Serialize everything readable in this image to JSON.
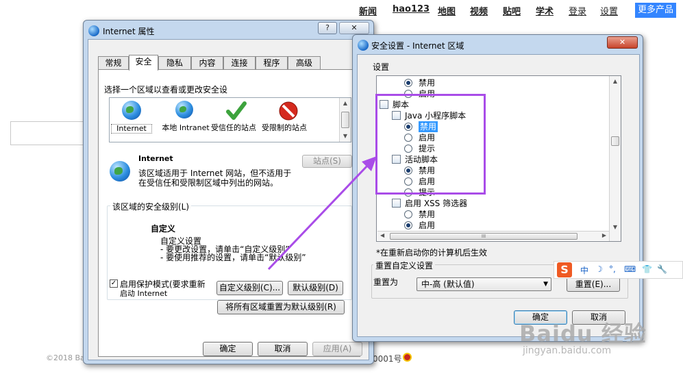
{
  "baidu": {
    "nav": [
      "新闻",
      "hao123",
      "地图",
      "视频",
      "贴吧",
      "学术",
      "登录",
      "设置"
    ],
    "more": "更多产品",
    "footer_copy": "©2018 Ba",
    "footer_icp": "0001号"
  },
  "internet_options": {
    "title": "Internet 属性",
    "help": "?",
    "close": "✕",
    "tabs": [
      "常规",
      "安全",
      "隐私",
      "内容",
      "连接",
      "程序",
      "高级"
    ],
    "active_tab": "安全",
    "select_zone_prompt": "选择一个区域以查看或更改安全设",
    "zones": [
      {
        "label": "Internet",
        "icon": "globe-icon"
      },
      {
        "label": "本地 Intranet",
        "icon": "intranet-icon"
      },
      {
        "label": "受信任的站点",
        "icon": "checkmark-icon"
      },
      {
        "label": "受限制的站点",
        "icon": "restricted-icon"
      }
    ],
    "zone_name": "Internet",
    "zone_desc_line1": "该区域适用于 Internet 网站，但不适用于",
    "zone_desc_line2": "在受信任和受限制区域中列出的网站。",
    "sites_button": "站点(S)",
    "security_level_group": "该区域的安全级别(L)",
    "custom_title": "自定义",
    "custom_line1": "自定义设置",
    "custom_line2": "- 要更改设置，请单击“自定义级别”",
    "custom_line3": "- 要使用推荐的设置，请单击“默认级别”",
    "protected_mode_line1": "启用保护模式(要求重新",
    "protected_mode_line2": "启动 Internet",
    "protected_mode_checked": true,
    "custom_level_button": "自定义级别(C)...",
    "default_level_button": "默认级别(D)",
    "reset_all_button": "将所有区域重置为默认级别(R)",
    "ok": "确定",
    "cancel": "取消",
    "apply": "应用(A)"
  },
  "security_settings": {
    "title": "安全设置 - Internet 区域",
    "close": "✕",
    "settings_label": "设置",
    "rows": [
      {
        "type": "radio",
        "label": "禁用",
        "checked": true,
        "indent": 2
      },
      {
        "type": "radio",
        "label": "启用",
        "checked": false,
        "indent": 2
      },
      {
        "type": "category",
        "label": "脚本",
        "indent": 0
      },
      {
        "type": "category",
        "label": "Java 小程序脚本",
        "indent": 1
      },
      {
        "type": "radio",
        "label": "禁用",
        "checked": true,
        "indent": 2,
        "selected": true
      },
      {
        "type": "radio",
        "label": "启用",
        "checked": false,
        "indent": 2
      },
      {
        "type": "radio",
        "label": "提示",
        "checked": false,
        "indent": 2
      },
      {
        "type": "category",
        "label": "活动脚本",
        "indent": 1
      },
      {
        "type": "radio",
        "label": "禁用",
        "checked": true,
        "indent": 2
      },
      {
        "type": "radio",
        "label": "启用",
        "checked": false,
        "indent": 2
      },
      {
        "type": "radio",
        "label": "提示",
        "checked": false,
        "indent": 2
      },
      {
        "type": "category",
        "label": "启用 XSS 筛选器",
        "indent": 1
      },
      {
        "type": "radio",
        "label": "禁用",
        "checked": false,
        "indent": 2
      },
      {
        "type": "radio",
        "label": "启用",
        "checked": true,
        "indent": 2
      }
    ],
    "restart_note": "*在重新启动你的计算机后生效",
    "reset_group": "重置自定义设置",
    "reset_to_label": "重置为",
    "reset_to_value": "中-高 (默认值)",
    "reset_button": "重置(E)...",
    "ok": "确定",
    "cancel": "取消"
  },
  "ime_toolbar": {
    "logo": "S",
    "items": [
      "中",
      "☽",
      "°,",
      "⌨",
      "👕",
      "🔧"
    ]
  },
  "watermark": {
    "main": "Baidu 经验",
    "sub": "jingyan.baidu.com"
  }
}
